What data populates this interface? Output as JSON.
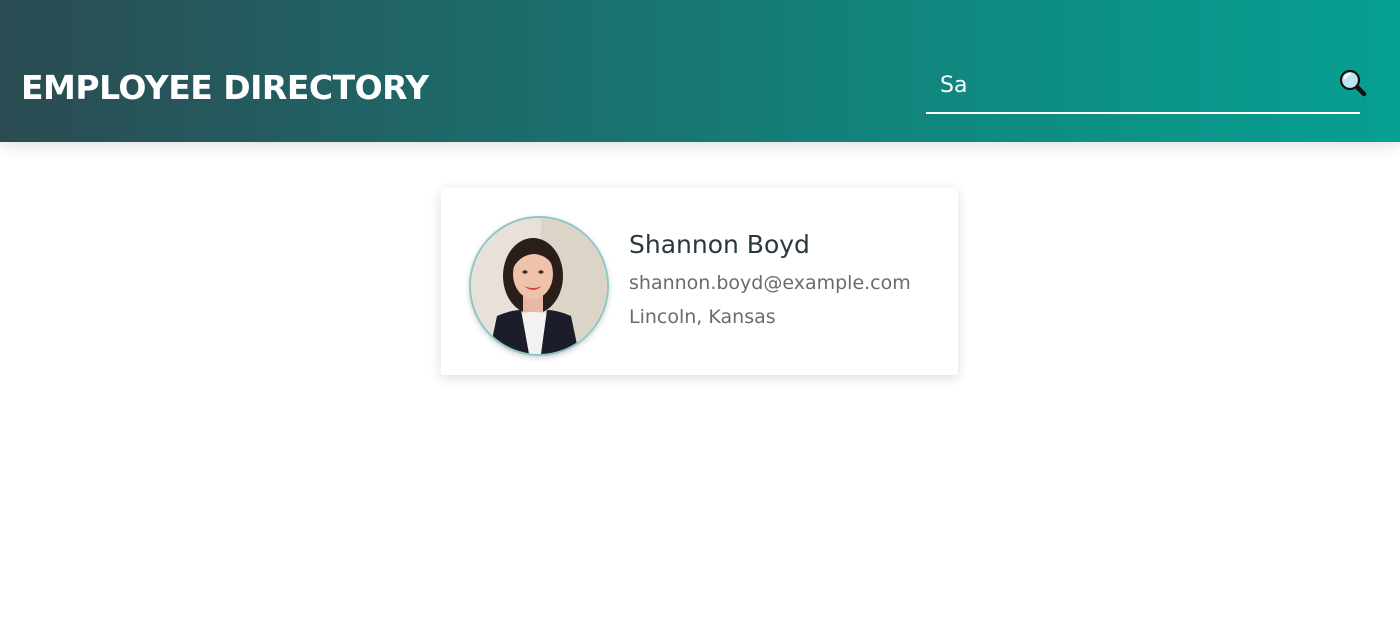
{
  "header": {
    "title": "EMPLOYEE DIRECTORY",
    "search": {
      "value": "Sa",
      "icon": "search-icon"
    }
  },
  "results": [
    {
      "name": "Shannon Boyd",
      "email": "shannon.boyd@example.com",
      "location": "Lincoln, Kansas"
    }
  ],
  "colors": {
    "header_gradient_start": "#2b4b52",
    "header_gradient_end": "#06a092",
    "name_text": "#28393d",
    "secondary_text": "#6b6b6b"
  }
}
